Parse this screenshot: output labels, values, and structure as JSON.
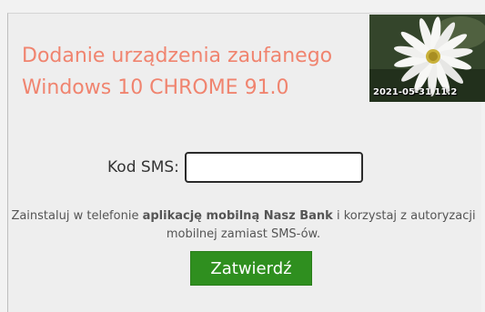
{
  "header": {
    "title_line1": "Dodanie urządzenia zaufanego",
    "title_line2": "Windows 10 CHROME 91.0"
  },
  "security_image": {
    "icon": "daisy-flower-photo",
    "date_text": "2021-05-31 11:2"
  },
  "form": {
    "sms_label": "Kod SMS:",
    "sms_value": "",
    "info_prefix": "Zainstaluj w telefonie ",
    "info_bold": "aplikację mobilną Nasz Bank",
    "info_suffix": " i korzystaj z autoryzacji mobilnej zamiast SMS-ów.",
    "submit_label": "Zatwierdź"
  },
  "colors": {
    "title": "#f0846f",
    "submit_bg": "#2f8f1f",
    "submit_text": "#ffffff"
  }
}
